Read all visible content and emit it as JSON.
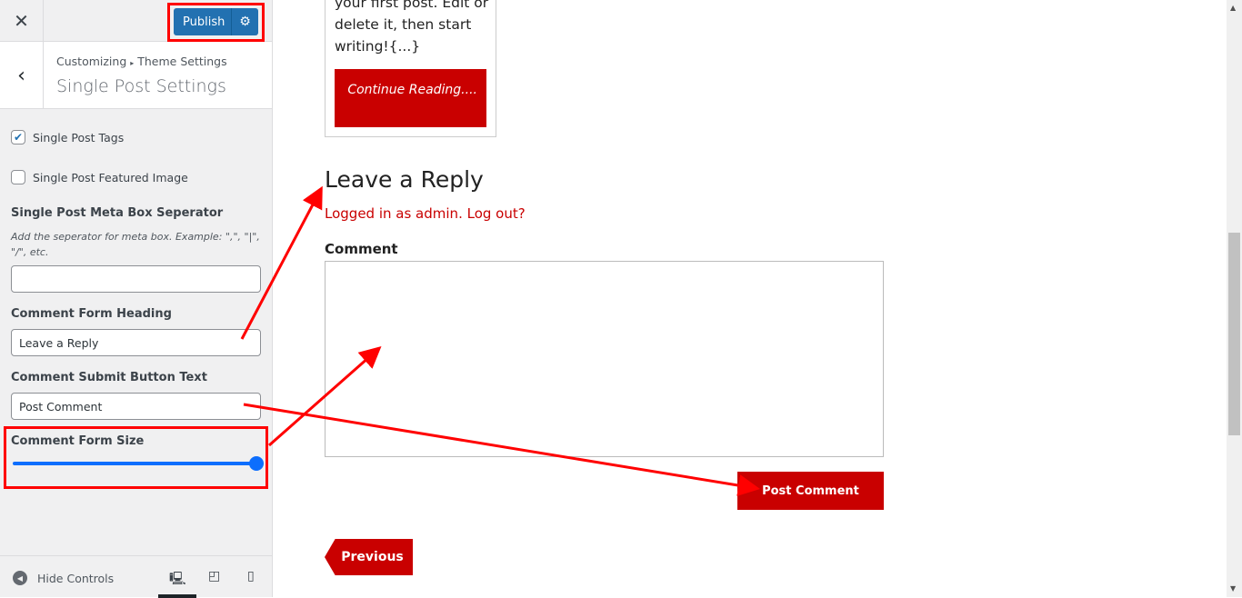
{
  "sidebar": {
    "publish_label": "Publish",
    "breadcrumb": [
      "Customizing",
      "Theme Settings"
    ],
    "title": "Single Post Settings",
    "single_post_tags": {
      "label": "Single Post Tags",
      "checked": true
    },
    "featured_image": {
      "label": "Single Post Featured Image",
      "checked": false
    },
    "meta_sep": {
      "label": "Single Post Meta Box Seperator",
      "description": "Add the seperator for meta box. Example: \",\", \"|\", \"/\", etc.",
      "value": ""
    },
    "form_heading": {
      "label": "Comment Form Heading",
      "value": "Leave a Reply"
    },
    "submit_text": {
      "label": "Comment Submit Button Text",
      "value": "Post Comment"
    },
    "form_size": {
      "label": "Comment Form Size",
      "value_percent": 100
    },
    "hide_controls": "Hide Controls",
    "devices": [
      "desktop",
      "tablet",
      "mobile"
    ],
    "selected_device": "desktop"
  },
  "preview": {
    "excerpt": "your first post. Edit or delete it, then start writing!{...}",
    "continue": "Continue Reading....",
    "heading": "Leave a Reply",
    "logged_in": "Logged in as admin",
    "logout": "Log out?",
    "comment_label": "Comment",
    "post_button": "Post Comment",
    "previous": "Previous"
  },
  "colors": {
    "accent": "#2271b1",
    "brand_red": "#c90000",
    "annotation": "#ff0000"
  }
}
